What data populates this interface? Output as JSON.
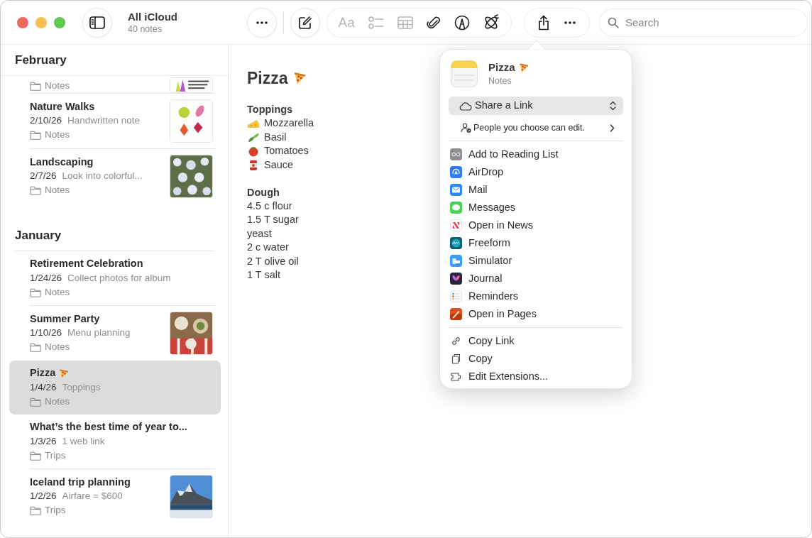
{
  "window": {
    "folder_title": "All iCloud",
    "note_count": "40 notes"
  },
  "toolbar": {
    "tools": [
      {
        "kind": "format",
        "label": "Aa",
        "disabled": true
      },
      {
        "kind": "checklist",
        "disabled": true
      },
      {
        "kind": "table",
        "disabled": true
      },
      {
        "kind": "attach",
        "disabled": false
      },
      {
        "kind": "markup",
        "disabled": false
      },
      {
        "kind": "writing",
        "disabled": false
      }
    ]
  },
  "search": {
    "placeholder": "Search"
  },
  "sidebar": {
    "sections": [
      {
        "title": "February",
        "notes": [
          {
            "folder": "Notes",
            "thumbnail": true,
            "cut_off": true,
            "selected": false
          },
          {
            "title": "Nature Walks",
            "date": "2/10/26",
            "preview": "Handwritten note",
            "folder": "Notes",
            "thumbnail": true,
            "cut_off": false,
            "selected": false
          },
          {
            "title": "Landscaping",
            "date": "2/7/26",
            "preview": "Look into colorful...",
            "folder": "Notes",
            "thumbnail": true,
            "cut_off": false,
            "selected": false
          }
        ]
      },
      {
        "title": "January",
        "notes": [
          {
            "title": "Retirement Celebration",
            "date": "1/24/26",
            "preview": "Collect photos for album",
            "folder": "Notes",
            "thumbnail": false,
            "cut_off": false,
            "selected": false
          },
          {
            "title": "Summer Party",
            "date": "1/10/26",
            "preview": "Menu planning",
            "folder": "Notes",
            "thumbnail": true,
            "cut_off": false,
            "selected": false
          },
          {
            "title": "Pizza",
            "title_icon": true,
            "date": "1/4/26",
            "preview": "Toppings",
            "folder": "Notes",
            "thumbnail": false,
            "cut_off": false,
            "selected": true
          },
          {
            "title": "What’s the best time of year to...",
            "date": "1/3/26",
            "preview": "1 web link",
            "folder": "Trips",
            "thumbnail": false,
            "cut_off": false,
            "selected": false
          },
          {
            "title": "Iceland trip planning",
            "date": "1/2/26",
            "preview": "Airfare = $600",
            "folder": "Trips",
            "thumbnail": true,
            "cut_off": false,
            "selected": false
          }
        ]
      }
    ]
  },
  "note": {
    "title": "Pizza",
    "title_icon": true,
    "sections": [
      {
        "heading": "Toppings",
        "lines": [
          {
            "text": "Mozzarella",
            "kind": "cheese"
          },
          {
            "text": "Basil",
            "kind": "herb"
          },
          {
            "text": "Tomatoes",
            "kind": "tomato"
          },
          {
            "text": "Sauce",
            "kind": "can"
          }
        ]
      },
      {
        "heading": "Dough",
        "lines": [
          {
            "text": "4.5 c flour",
            "kind": "plain"
          },
          {
            "text": "1.5 T sugar",
            "kind": "plain"
          },
          {
            "text": "yeast",
            "kind": "plain"
          },
          {
            "text": "2 c water",
            "kind": "plain"
          },
          {
            "text": "2 T olive oil",
            "kind": "plain"
          },
          {
            "text": "1 T salt",
            "kind": "plain"
          }
        ]
      }
    ]
  },
  "share_sheet": {
    "title": "Pizza",
    "title_icon": true,
    "subtitle": "Notes",
    "link_option": "Share a Link",
    "permission": "People you choose can edit.",
    "apps": [
      {
        "label": "Add to Reading List",
        "kind": "reading_list"
      },
      {
        "label": "AirDrop",
        "kind": "airdrop"
      },
      {
        "label": "Mail",
        "kind": "mail"
      },
      {
        "label": "Messages",
        "kind": "messages"
      },
      {
        "label": "Open in News",
        "kind": "news"
      },
      {
        "label": "Freeform",
        "kind": "freeform"
      },
      {
        "label": "Simulator",
        "kind": "simulator"
      },
      {
        "label": "Journal",
        "kind": "journal"
      },
      {
        "label": "Reminders",
        "kind": "reminders"
      },
      {
        "label": "Open in Pages",
        "kind": "pages"
      }
    ],
    "actions": [
      {
        "label": "Copy Link",
        "kind": "link"
      },
      {
        "label": "Copy",
        "kind": "copy"
      },
      {
        "label": "Edit Extensions...",
        "kind": "extensions"
      }
    ]
  }
}
